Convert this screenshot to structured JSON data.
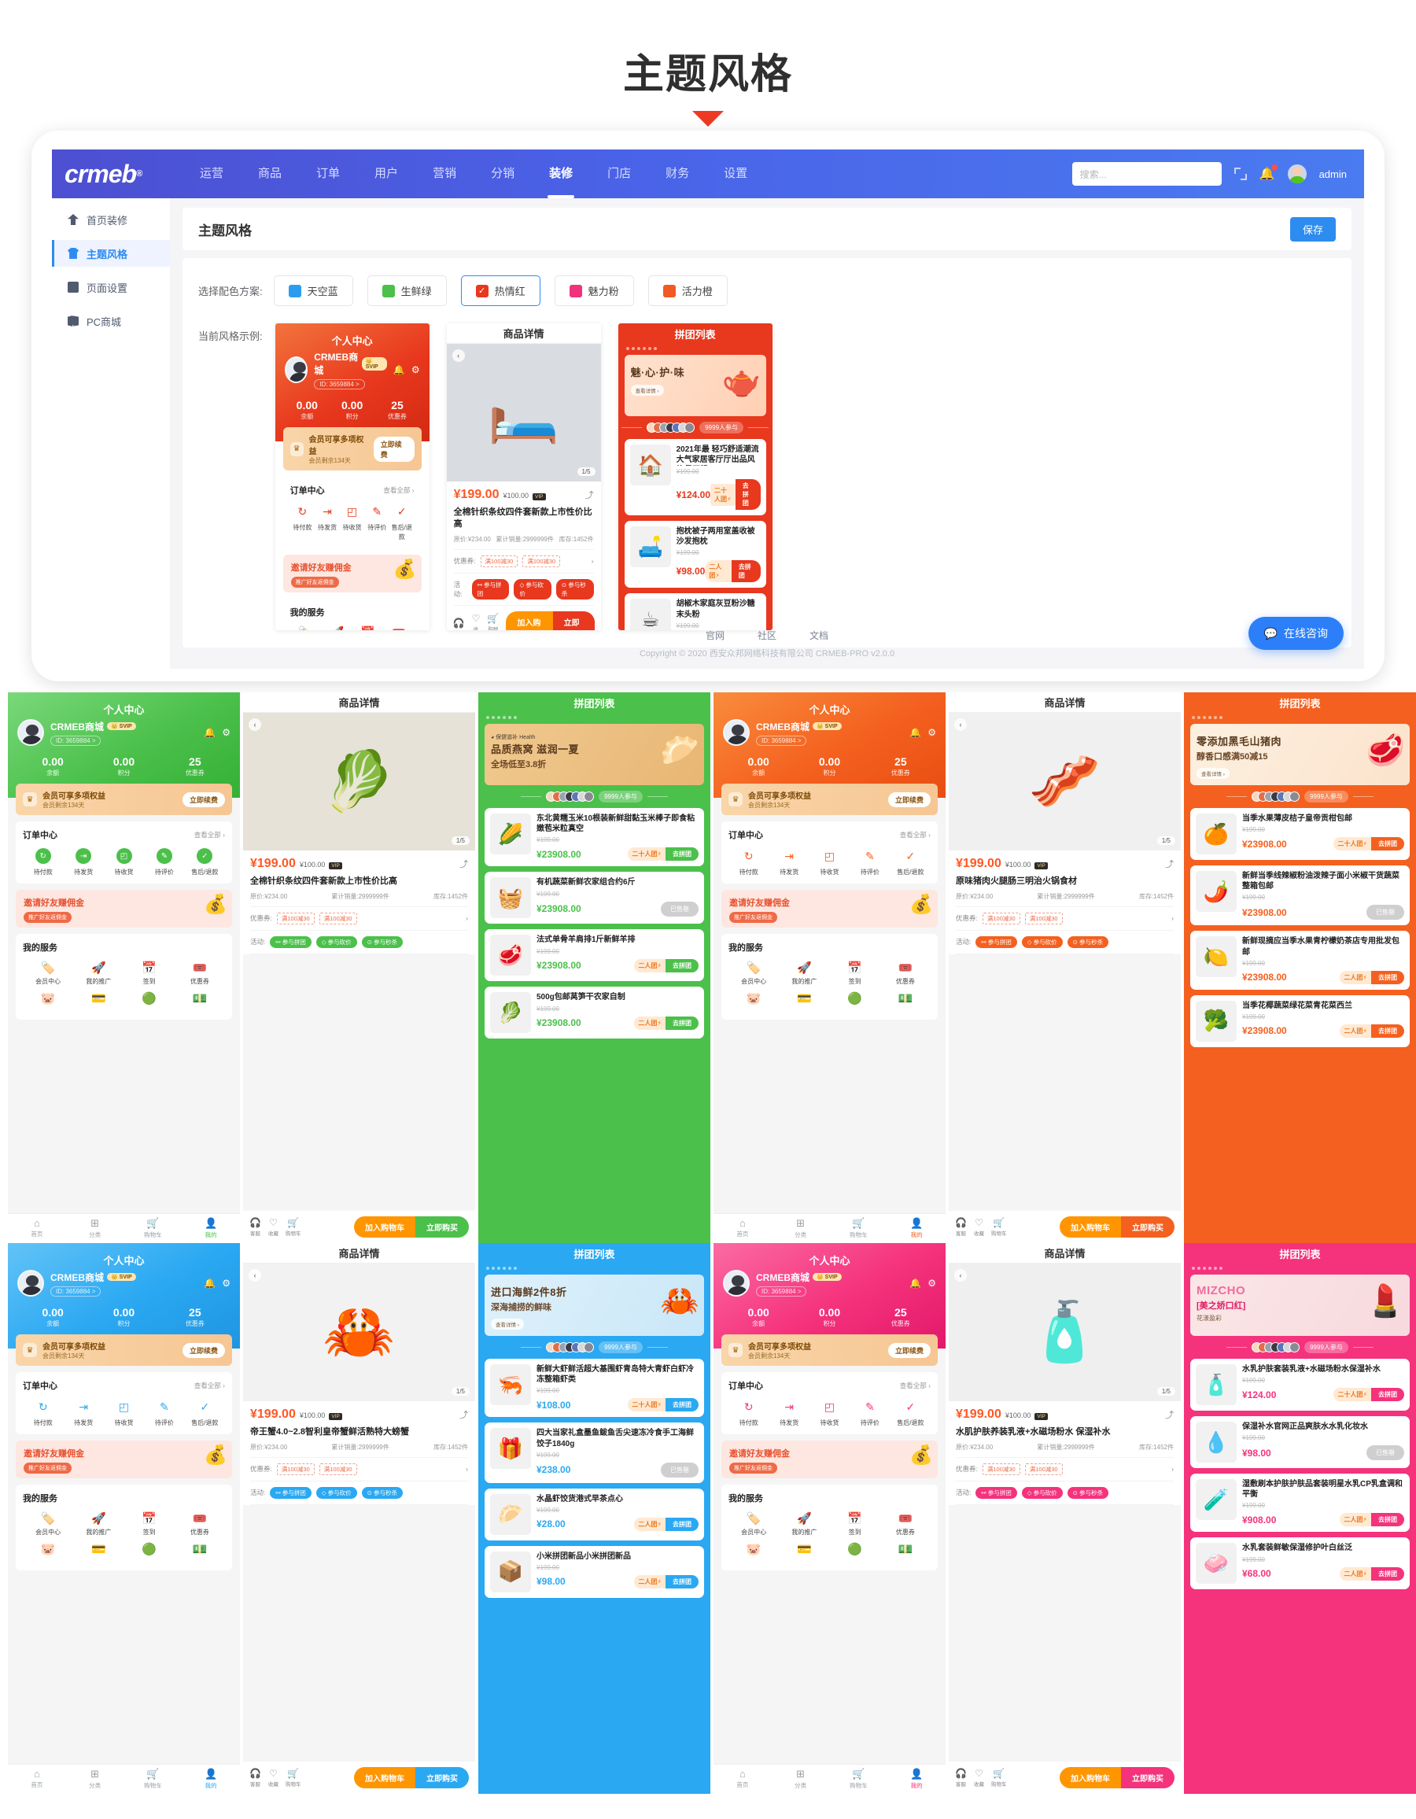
{
  "page": {
    "title": "主题风格"
  },
  "admin": {
    "logo": "crmeb",
    "nav": [
      {
        "label": "运营",
        "active": false
      },
      {
        "label": "商品",
        "active": false
      },
      {
        "label": "订单",
        "active": false
      },
      {
        "label": "用户",
        "active": false
      },
      {
        "label": "营销",
        "active": false
      },
      {
        "label": "分销",
        "active": false
      },
      {
        "label": "装修",
        "active": true
      },
      {
        "label": "门店",
        "active": false
      },
      {
        "label": "财务",
        "active": false
      },
      {
        "label": "设置",
        "active": false
      }
    ],
    "search_placeholder": "搜索...",
    "user_name": "admin",
    "sidebar": [
      {
        "label": "首页装修",
        "icon": "upload-icon",
        "active": false
      },
      {
        "label": "主题风格",
        "icon": "shirt-icon",
        "active": true
      },
      {
        "label": "页面设置",
        "icon": "folder-icon",
        "active": false
      },
      {
        "label": "PC商城",
        "icon": "pc-icon",
        "active": false
      }
    ],
    "panel_title": "主题风格",
    "save_label": "保存",
    "color_label": "选择配色方案:",
    "colors": [
      {
        "name": "天空蓝",
        "hex": "#2d9cf0",
        "selected": false
      },
      {
        "name": "生鲜绿",
        "hex": "#4bc04b",
        "selected": false
      },
      {
        "name": "热情红",
        "hex": "#e8381e",
        "selected": true
      },
      {
        "name": "魅力粉",
        "hex": "#f0327c",
        "selected": false
      },
      {
        "name": "活力橙",
        "hex": "#f05a23",
        "selected": false
      }
    ],
    "preview_label": "当前风格示例:",
    "footer_links": [
      "官网",
      "社区",
      "文档"
    ],
    "copyright": "Copyright © 2020 西安众邦网络科技有限公司 CRMEB-PRO v2.0.0",
    "chat_label": "在线咨询"
  },
  "user_center": {
    "title": "个人中心",
    "name": "CRMEB商城",
    "vip_badge": "SVIP",
    "id": "ID: 3659884 >",
    "stats": [
      {
        "value": "0.00",
        "label": "余额"
      },
      {
        "value": "0.00",
        "label": "积分"
      },
      {
        "value": "25",
        "label": "优惠券"
      }
    ],
    "vip_title": "会员可享多项权益",
    "vip_sub": "会员剩余134天",
    "vip_btn": "立即续费",
    "order_title": "订单中心",
    "order_more": "查看全部 ›",
    "order_items": [
      "待付款",
      "待发货",
      "待收货",
      "待评价",
      "售后/退款"
    ],
    "invite_title": "邀请好友赚佣金",
    "invite_tag": "推广好友返佣金",
    "service_title": "我的服务",
    "services": [
      "会员中心",
      "我的推广",
      "签到",
      "优惠券"
    ],
    "tabs": [
      "首页",
      "分类",
      "购物车",
      "我的"
    ]
  },
  "product_detail": {
    "title": "商品详情",
    "image_count": "1/5",
    "price": "¥199.00",
    "old_price": "¥100.00",
    "vip_tag": "VIP",
    "name": "全棉针织条纹四件套新款上市性价比高",
    "orig": "原价:¥234.00",
    "sales": "累计销量:2999999件",
    "stock": "库存:1452件",
    "coupon_label": "优惠券:",
    "coupons": [
      "满100减30",
      "满100减30"
    ],
    "activity_label": "活动:",
    "activities": [
      "参与拼团",
      "参与砍价",
      "参与秒杀"
    ],
    "bar_icons": [
      "客服",
      "收藏",
      "购物车"
    ],
    "add_cart": "加入购物车",
    "buy_now": "立即购买",
    "variants": [
      {
        "name": "原味猪肉火腿肠三明治火锅食材"
      },
      {
        "name": "帝王蟹4.0~2.8智利皇帝蟹鲜活熟特大螃蟹"
      },
      {
        "name": "水肌护肤养装乳液+水磁场粉水 保湿补水"
      }
    ]
  },
  "group_list": {
    "title": "拼团列表",
    "participants": "9999人参与",
    "banner_cta": "查看详情 ›",
    "team_20": "二十人团",
    "team_2": "二人团",
    "go_btn": "去拼团",
    "sold_out": "已售罄",
    "banners": {
      "green": {
        "tag": "保健滋补 Health",
        "line1": "品质燕窝 滋润一夏",
        "line2": "全场低至3.8折"
      },
      "orange": {
        "line1": "零添加黑毛山猪肉",
        "line2": "醇香口感满50减15"
      },
      "blue": {
        "line1": "进口海鲜2件8折",
        "line2": "深海捕捞的鲜味"
      },
      "pink": {
        "line1": "MIZCHO",
        "line2": "[美之娇口红]",
        "line3": "花漾盈彩"
      }
    },
    "items_green": [
      {
        "name": "东北黄糯玉米10根装新鲜甜黏玉米棒子即食粘嫩苞米粒真空",
        "old": "¥199.00",
        "new": "¥23908.00",
        "team": "二十人团",
        "state": "go",
        "emoji": "🌽"
      },
      {
        "name": "有机蔬菜新鲜农家组合约6斤",
        "old": "¥199.00",
        "new": "¥23908.00",
        "team": "",
        "state": "sold",
        "emoji": "🧺"
      },
      {
        "name": "法式单骨羊肩排1斤新鲜羊排",
        "old": "¥199.00",
        "new": "¥23908.00",
        "team": "二人团",
        "state": "go",
        "emoji": "🥩"
      },
      {
        "name": "500g包邮莴笋干农家自制",
        "old": "¥199.00",
        "new": "¥23908.00",
        "team": "二人团",
        "state": "go",
        "emoji": "🥬"
      }
    ],
    "items_orange": [
      {
        "name": "当季水果薄皮桔子皇帝贡柑包邮",
        "old": "¥199.00",
        "new": "¥23908.00",
        "team": "二十人团",
        "state": "go",
        "emoji": "🍊"
      },
      {
        "name": "新鲜当季线辣椒粉油泼辣子面小米椒干货蔬菜整箱包邮",
        "old": "¥199.00",
        "new": "¥23908.00",
        "team": "",
        "state": "sold",
        "emoji": "🌶️"
      },
      {
        "name": "新鲜现摘应当季水果青柠檬奶茶店专用批发包邮",
        "old": "¥199.00",
        "new": "¥23908.00",
        "team": "二人团",
        "state": "go",
        "emoji": "🍋"
      },
      {
        "name": "当季花椰蔬菜绿花菜青花菜西兰",
        "old": "¥199.00",
        "new": "¥23908.00",
        "team": "二人团",
        "state": "go",
        "emoji": "🥦"
      }
    ],
    "items_blue": [
      {
        "name": "新鲜大虾鲜活超大基围虾青岛特大青虾白虾冷冻整箱虾类",
        "old": "¥199.00",
        "new": "¥108.00",
        "team": "二十人团",
        "state": "go",
        "emoji": "🦐"
      },
      {
        "name": "四大当家礼盒墨鱼鲅鱼舌尖速冻冷食手工海鲜饺子1840g",
        "old": "¥199.00",
        "new": "¥238.00",
        "team": "",
        "state": "sold",
        "emoji": "🎁"
      },
      {
        "name": "水晶虾饺货港式早茶点心",
        "old": "¥199.00",
        "new": "¥28.00",
        "team": "二人团",
        "state": "go",
        "emoji": "🥟"
      },
      {
        "name": "小米拼团新品小米拼团新品",
        "old": "¥199.00",
        "new": "¥98.00",
        "team": "二人团",
        "state": "go",
        "emoji": "📦"
      }
    ],
    "items_pink": [
      {
        "name": "水乳护肤套装乳液+水磁场粉水保湿补水",
        "old": "¥199.00",
        "new": "¥124.00",
        "team": "二十人团",
        "state": "go",
        "emoji": "🧴"
      },
      {
        "name": "保湿补水官网正品爽肤水水乳化妆水",
        "old": "¥199.00",
        "new": "¥98.00",
        "team": "",
        "state": "sold",
        "emoji": "💧"
      },
      {
        "name": "湿敷刷本护肤护肤品套装明星水乳CP乳盒调和平衡",
        "old": "¥199.00",
        "new": "¥908.00",
        "team": "二人团",
        "state": "go",
        "emoji": "🧪"
      },
      {
        "name": "水乳套装鲜敏保湿修护叶白丝泛",
        "old": "¥199.00",
        "new": "¥68.00",
        "team": "二人团",
        "state": "go",
        "emoji": "🧼"
      }
    ]
  },
  "themes": [
    {
      "key": "green",
      "primary": "#4bc04b",
      "dark": "#35b035",
      "light": "#7ad87a"
    },
    {
      "key": "orange",
      "primary": "#f4601f",
      "dark": "#e84e12",
      "light": "#f98c3d"
    },
    {
      "key": "blue",
      "primary": "#2aa8f2",
      "dark": "#1f95e0",
      "light": "#62c3f7"
    },
    {
      "key": "pink",
      "primary": "#f5327c",
      "dark": "#e2186a",
      "light": "#fb6ba2"
    }
  ]
}
